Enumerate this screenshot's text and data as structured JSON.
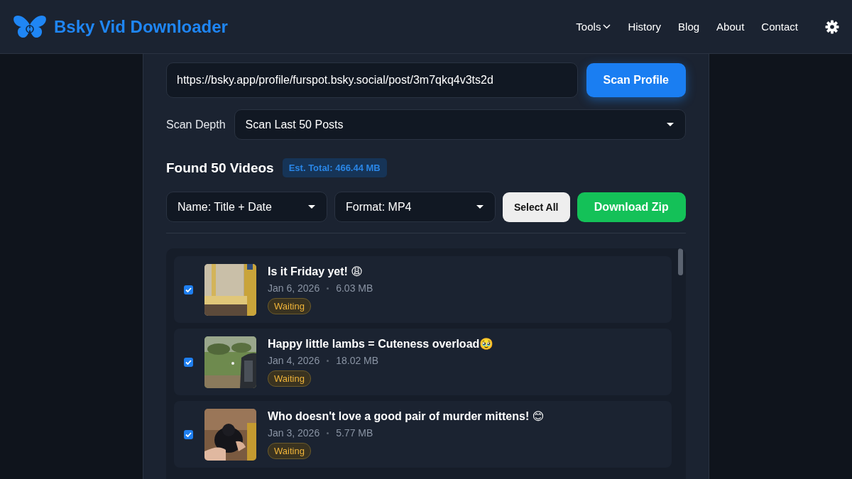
{
  "brand": {
    "name": "Bsky Vid Downloader"
  },
  "nav": [
    {
      "label": "Tools",
      "kind": "menu"
    },
    {
      "label": "History",
      "kind": "link"
    },
    {
      "label": "Blog",
      "kind": "link"
    },
    {
      "label": "About",
      "kind": "link"
    },
    {
      "label": "Contact",
      "kind": "link"
    }
  ],
  "url_field": {
    "value": "https://bsky.app/profile/furspot.bsky.social/post/3m7qkq4v3ts2d"
  },
  "scan_button": "Scan Profile",
  "scan_depth": {
    "label": "Scan Depth",
    "value": "Scan Last 50 Posts"
  },
  "results": {
    "title": "Found 50 Videos",
    "total": "Est. Total: 466.44 MB"
  },
  "name_select": "Name: Title + Date",
  "format_select": "Format: MP4",
  "select_all": "Select All",
  "download_zip": "Download Zip",
  "videos": [
    {
      "title": "Is it Friday yet! 😩",
      "date": "Jan 6, 2026",
      "size": "6.03 MB",
      "status": "Waiting",
      "checked": true,
      "kind": "picture"
    },
    {
      "title": "Happy little lambs = Cuteness overload🥹",
      "date": "Jan 4, 2026",
      "size": "18.02 MB",
      "status": "Waiting",
      "checked": true,
      "kind": "picture"
    },
    {
      "title": "Who doesn't love a good pair of murder mittens! 😊",
      "date": "Jan 3, 2026",
      "size": "5.77 MB",
      "status": "Waiting",
      "checked": true,
      "kind": "picture"
    }
  ]
}
